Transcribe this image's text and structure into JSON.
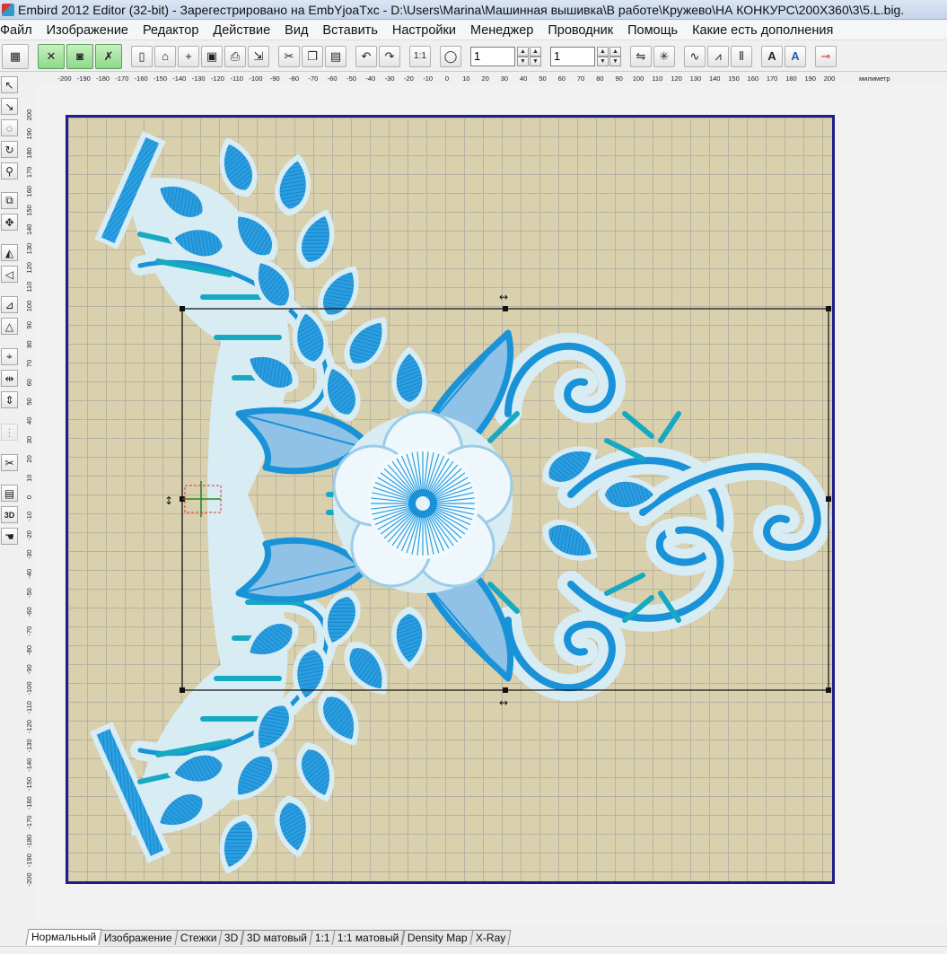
{
  "window": {
    "title": "Embird 2012 Editor (32-bit) - Зарегестрировано на EmbYjoaTxc - D:\\Users\\Marina\\Машинная вышивка\\В работе\\Кружево\\НА КОНКУРС\\200X360\\3\\5.L.big."
  },
  "menu": [
    "Файл",
    "Изображение",
    "Редактор",
    "Действие",
    "Вид",
    "Вставить",
    "Настройки",
    "Менеджер",
    "Проводник",
    "Помощь",
    "Какие есть дополнения"
  ],
  "toolbar": {
    "spin1_value": "1",
    "spin2_value": "1",
    "icons": [
      "grid-icon",
      "tool-a-icon",
      "camera-icon",
      "tool-x-icon",
      "new-file-icon",
      "open-folder-icon",
      "add-file-icon",
      "save-icon",
      "print-icon",
      "export-icon",
      "cut-icon",
      "copy-icon",
      "paste-icon",
      "undo-icon",
      "redo-icon",
      "scale-1-1-icon",
      "stop-icon",
      "flip-icon",
      "mirror-icon",
      "wave-icon",
      "chart-icon",
      "bars-icon",
      "text-icon",
      "text-alt-icon",
      "key-icon"
    ]
  },
  "ruler": {
    "units": "милиметр",
    "h_ticks": [
      "-200",
      "-190",
      "-180",
      "-170",
      "-160",
      "-150",
      "-140",
      "-130",
      "-120",
      "-110",
      "-100",
      "-90",
      "-80",
      "-70",
      "-60",
      "-50",
      "-40",
      "-30",
      "-20",
      "-10",
      "0",
      "10",
      "20",
      "30",
      "40",
      "50",
      "60",
      "70",
      "80",
      "90",
      "100",
      "110",
      "120",
      "130",
      "140",
      "150",
      "160",
      "170",
      "180",
      "190",
      "200"
    ],
    "v_ticks": [
      "200",
      "190",
      "180",
      "170",
      "160",
      "150",
      "140",
      "130",
      "120",
      "110",
      "100",
      "90",
      "80",
      "70",
      "60",
      "50",
      "40",
      "30",
      "20",
      "10",
      "0",
      "-10",
      "-20",
      "-30",
      "-40",
      "-50",
      "-60",
      "-70",
      "-80",
      "-90",
      "-100",
      "-110",
      "-120",
      "-130",
      "-140",
      "-150",
      "-160",
      "-170",
      "-180",
      "-190",
      "-200"
    ]
  },
  "tabs": [
    "Нормальный",
    "Изображение",
    "Стежки",
    "3D",
    "3D матовый",
    "1:1",
    "1:1 матовый",
    "Density Map",
    "X-Ray"
  ],
  "active_tab": "Нормальный",
  "colors": {
    "hoop_border": "#1e1e8a",
    "fabric": "#d9d0ad",
    "thread_blue": "#1a92d8",
    "thread_light": "#d8ecf4",
    "thread_teal": "#17a9c2",
    "leaf_fill": "#8fc2e6"
  }
}
